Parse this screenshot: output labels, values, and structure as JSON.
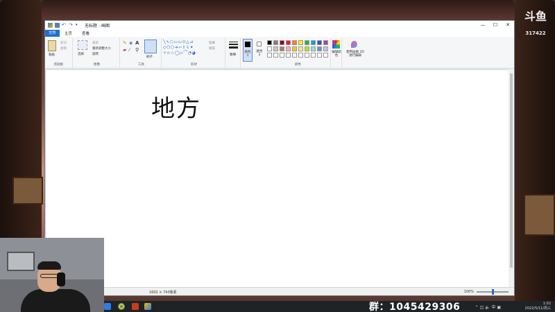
{
  "window": {
    "title": "无标题 - 画图",
    "controls": {
      "minimize": "—",
      "maximize": "☐",
      "close": "✕"
    }
  },
  "menu": {
    "file": "文件",
    "home": "主页",
    "view": "查看"
  },
  "ribbon": {
    "clipboard": {
      "paste": "粘贴",
      "cut": "剪切",
      "copy": "复制",
      "group_label": "剪贴板"
    },
    "image": {
      "select": "选择",
      "crop": "裁剪",
      "resize": "重新调整大小",
      "rotate": "旋转",
      "group_label": "图像"
    },
    "tools": {
      "group_label": "工具"
    },
    "brushes": {
      "label": "刷子"
    },
    "shapes": {
      "outline": "轮廓",
      "fill": "填充",
      "group_label": "形状"
    },
    "size": {
      "label": "粗细"
    },
    "color1": {
      "label": "颜色 1"
    },
    "color2": {
      "label": "颜色 2"
    },
    "colors": {
      "group_label": "颜色",
      "edit_label": "编辑颜色",
      "row1": [
        "#000000",
        "#7f7f7f",
        "#880015",
        "#ed1c24",
        "#ff7f27",
        "#fff200",
        "#22b14c",
        "#00a2e8",
        "#3f48cc",
        "#a349a4"
      ],
      "row2": [
        "#ffffff",
        "#c3c3c3",
        "#b97a57",
        "#ffaec9",
        "#ffc90e",
        "#efe4b0",
        "#b5e61d",
        "#99d9ea",
        "#7092be",
        "#c8bfe7"
      ],
      "row3": [
        "#ffffff",
        "#ffffff",
        "#ffffff",
        "#ffffff",
        "#ffffff",
        "#ffffff",
        "#ffffff",
        "#ffffff",
        "#ffffff",
        "#ffffff"
      ]
    },
    "paint3d": {
      "label": "使用画图 3D 进行编辑"
    }
  },
  "canvas": {
    "handwriting": "地方"
  },
  "statusbar": {
    "dimensions": "1602 × 743像素",
    "zoom": "100%",
    "zoom_fraction": 0.5
  },
  "overlay": {
    "watermark": "斗鱼",
    "room_id": "317422",
    "group_number": "群：1045429306"
  },
  "taskbar": {
    "clock_time": "1:02",
    "clock_date": "2022/5/11/周三"
  }
}
